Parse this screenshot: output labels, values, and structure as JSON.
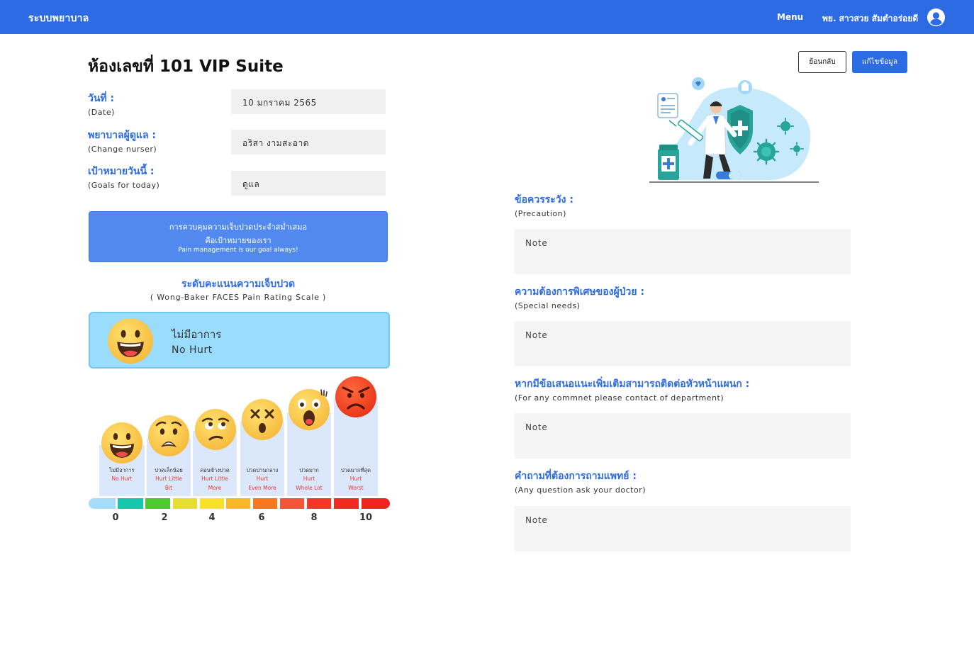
{
  "navbar": {
    "brand": "ระบบพยาบาล",
    "menu": "Menu",
    "user": "พย. สาวสวย สัมตำอร่อยดี"
  },
  "page": {
    "title": "ห้องเลขที่ 101 VIP Suite",
    "back_label": "ย้อนกลับ",
    "edit_label": "แก้ไขข้อมูล"
  },
  "fields": [
    {
      "label": "วันที่ :",
      "sub": "(Date)",
      "value": "10 มกราคม 2565"
    },
    {
      "label": "พยาบาลผู้ดูแล :",
      "sub": "(Change nurser)",
      "value": "อริสา งามสะอาด"
    },
    {
      "label": "เป้าหมายวันนี้ :",
      "sub": "(Goals for today)",
      "value": "ดูแล"
    }
  ],
  "banner": {
    "line1": "การควบคุมความเจ็บปวดประจำสม่ำเสมอ",
    "line2": "คือเป้าหมายของเรา",
    "line3": "Pain management is our goal always!"
  },
  "pain_scale": {
    "title": "ระดับคะแนนความเจ็บปวด",
    "subtitle": "( Wong-Baker FACES Pain Rating Scale )",
    "current": {
      "th": "ไม่มีอาการ",
      "en": "No Hurt",
      "face": "grinning-face-icon"
    },
    "levels": [
      {
        "th": "ไม่มีอาการ",
        "en1": "No Hurt",
        "en2": "",
        "face": "grinning-face-icon"
      },
      {
        "th": "ปวดเล็กน้อย",
        "en1": "Hurt Little",
        "en2": "Bit",
        "face": "worried-face-icon"
      },
      {
        "th": "ค่อนข้างปวด",
        "en1": "Hurt Little",
        "en2": "More",
        "face": "unamused-face-icon"
      },
      {
        "th": "ปวดปานกลาง",
        "en1": "Hurt",
        "en2": "Even More",
        "face": "dizzy-face-icon"
      },
      {
        "th": "ปวดมาก",
        "en1": "Hurt",
        "en2": "Whole Lot",
        "face": "screaming-face-icon"
      },
      {
        "th": "ปวดมากที่สุด",
        "en1": "Hurt",
        "en2": "Worst",
        "face": "angry-face-icon"
      }
    ],
    "bar_colors": [
      "#a5dcf9",
      "#14c7ad",
      "#4ccb2e",
      "#e6de30",
      "#f9e12a",
      "#f8b724",
      "#f9781e",
      "#f2553a",
      "#f4362a",
      "#f02b22",
      "#ef2420"
    ],
    "numbers": [
      "0",
      "2",
      "4",
      "6",
      "8",
      "10"
    ]
  },
  "right": [
    {
      "label": "ข้อควรระวัง :",
      "sub": "(Precaution)",
      "placeholder": "Note"
    },
    {
      "label": "ความต้องการพิเศษของผู้ป่วย :",
      "sub": "(Special needs)",
      "placeholder": "Note"
    },
    {
      "label": "หากมีข้อเสนอแนะเพิ่มเติมสามารถติดต่อหัวหน้าแผนก :",
      "sub": "(For any commnet please contact of department)",
      "placeholder": "Note"
    },
    {
      "label": "คำถามที่ต้องการถามแพทย์ :",
      "sub": "(Any question ask your doctor)",
      "placeholder": "Note"
    }
  ],
  "colors": {
    "primary": "#2d6be4",
    "banner": "#5189ee",
    "current_card": "#9adcfb",
    "column_bg": "#dbe7fb",
    "en_text": "#e53935"
  }
}
